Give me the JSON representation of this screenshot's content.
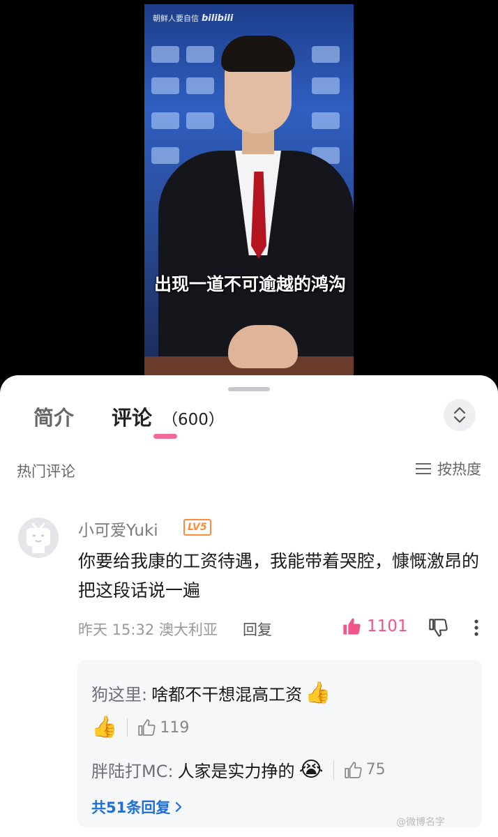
{
  "video": {
    "watermark": "朝鲜人要自信",
    "brand": "bilibili",
    "subtitle": "出现一道不可逾越的鸿沟"
  },
  "tabs": {
    "intro": "简介",
    "comments": "评论",
    "comment_count": "（600）"
  },
  "section": {
    "title": "热门评论",
    "sort_label": "按热度"
  },
  "comment": {
    "username": "小可爱Yuki",
    "level": "LV5",
    "text": "你要给我康的工资待遇，我能带着哭腔，慷慨激昂的把这段话说一遍",
    "meta": "昨天 15:32 澳大利亚",
    "reply_label": "回复",
    "like_count": "1101"
  },
  "replies": [
    {
      "user": "狗这里:",
      "text": "啥都不干想混高工资",
      "emoji": "👍",
      "like_count": "119"
    },
    {
      "user": "胖陆打MC:",
      "text": "人家是实力挣的",
      "emoji": "😭",
      "like_count": "75"
    }
  ],
  "view_all_replies": "共51条回复",
  "corner_watermark": "@微博名字",
  "colors": {
    "accent_pink": "#f16b9a",
    "like_pink": "#f0568a",
    "link_blue": "#1e6fd9",
    "level_orange": "#ff8a3d"
  }
}
